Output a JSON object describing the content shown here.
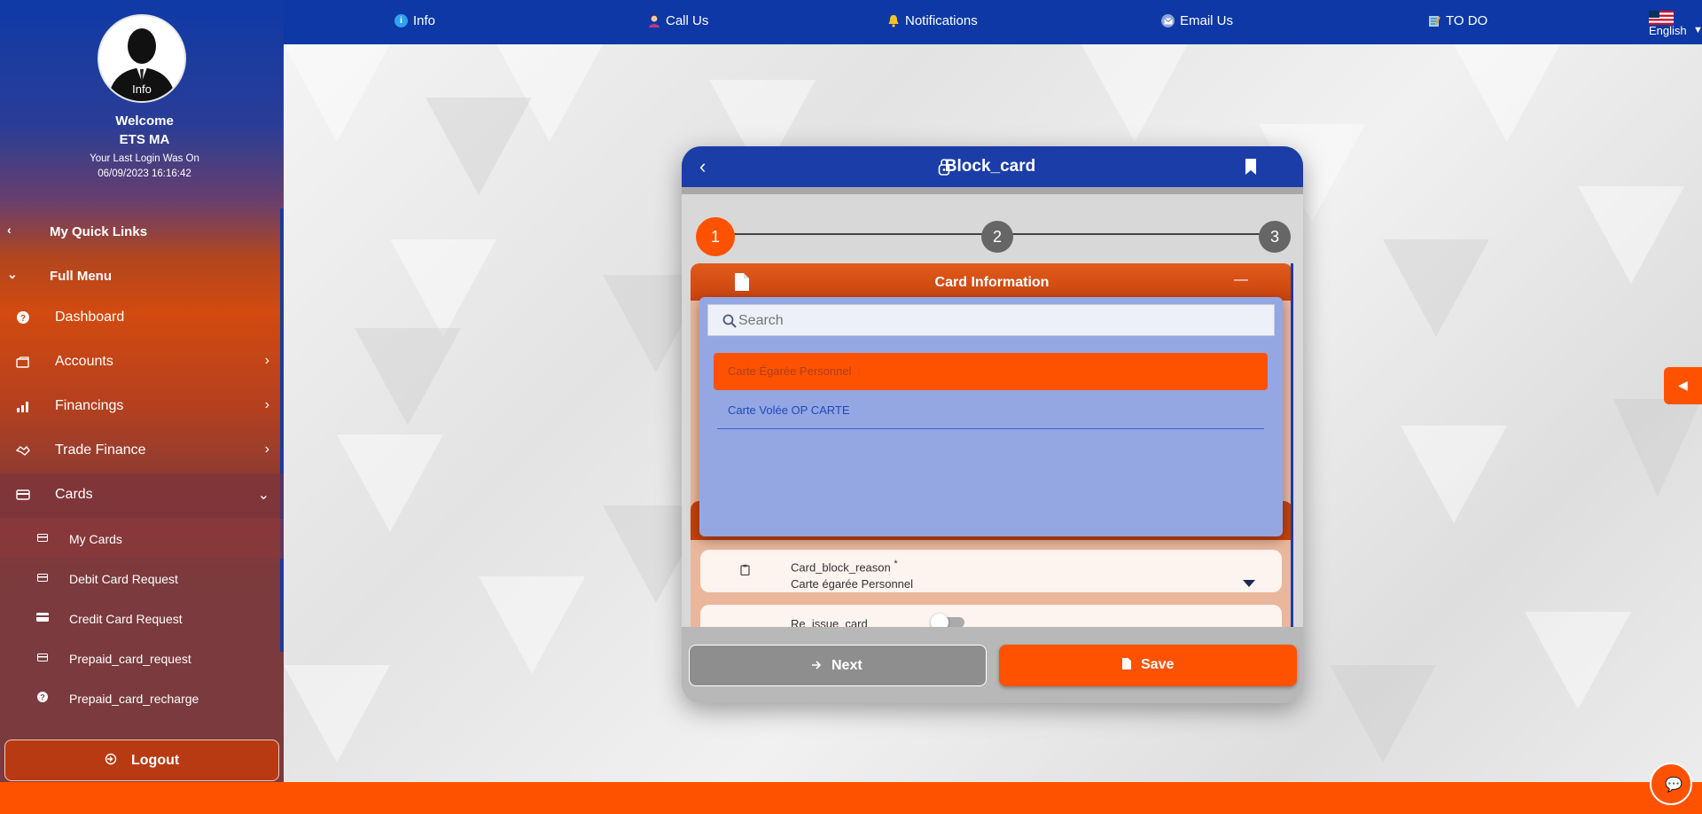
{
  "profile": {
    "avatar_label": "Info",
    "welcome": "Welcome",
    "user": "ETS MA",
    "last_login_label": "Your Last Login Was On",
    "last_login_time": "06/09/2023 16:16:42"
  },
  "sidebar": {
    "quick_links": "My Quick Links",
    "full_menu": "Full Menu",
    "items": [
      {
        "label": "Dashboard",
        "icon": "help-circle-icon"
      },
      {
        "label": "Accounts",
        "icon": "accounts-icon"
      },
      {
        "label": "Financings",
        "icon": "bar-chart-icon"
      },
      {
        "label": "Trade Finance",
        "icon": "handshake-icon"
      },
      {
        "label": "Cards",
        "icon": "card-icon"
      }
    ],
    "sub_items": [
      {
        "label": "My Cards",
        "icon": "card-icon"
      },
      {
        "label": "Debit Card Request",
        "icon": "card-icon"
      },
      {
        "label": "Credit Card Request",
        "icon": "credit-card-icon"
      },
      {
        "label": "Prepaid_card_request",
        "icon": "card-icon"
      },
      {
        "label": "Prepaid_card_recharge",
        "icon": "help-circle-icon"
      }
    ],
    "logout": "Logout"
  },
  "topbar": {
    "items": [
      {
        "label": "Info",
        "icon": "info-icon"
      },
      {
        "label": "Call Us",
        "icon": "agent-icon"
      },
      {
        "label": "Notifications",
        "icon": "bell-icon"
      },
      {
        "label": "Email Us",
        "icon": "envelope-icon"
      },
      {
        "label": "TO DO",
        "icon": "notepad-icon"
      }
    ],
    "language": "English"
  },
  "dialog": {
    "title": "Block_card",
    "steps": [
      "1",
      "2",
      "3"
    ],
    "active_step": 1,
    "section_title": "Card Information",
    "fields": {
      "block_reason_label": "Card_block_reason",
      "required_mark": "*",
      "block_reason_value": "Carte égarée Personnel",
      "reissue_label": "Re_issue_card"
    },
    "next_label": "Next",
    "save_label": "Save"
  },
  "dropdown": {
    "search_placeholder": "Search",
    "options": [
      "Carte Égarée Personnel",
      "Carte Volée OP CARTE"
    ],
    "selected_index": 0
  },
  "colors": {
    "brand_blue": "#0d38a5",
    "brand_orange": "#ff5200",
    "dropdown_bg": "#94a7e3"
  }
}
